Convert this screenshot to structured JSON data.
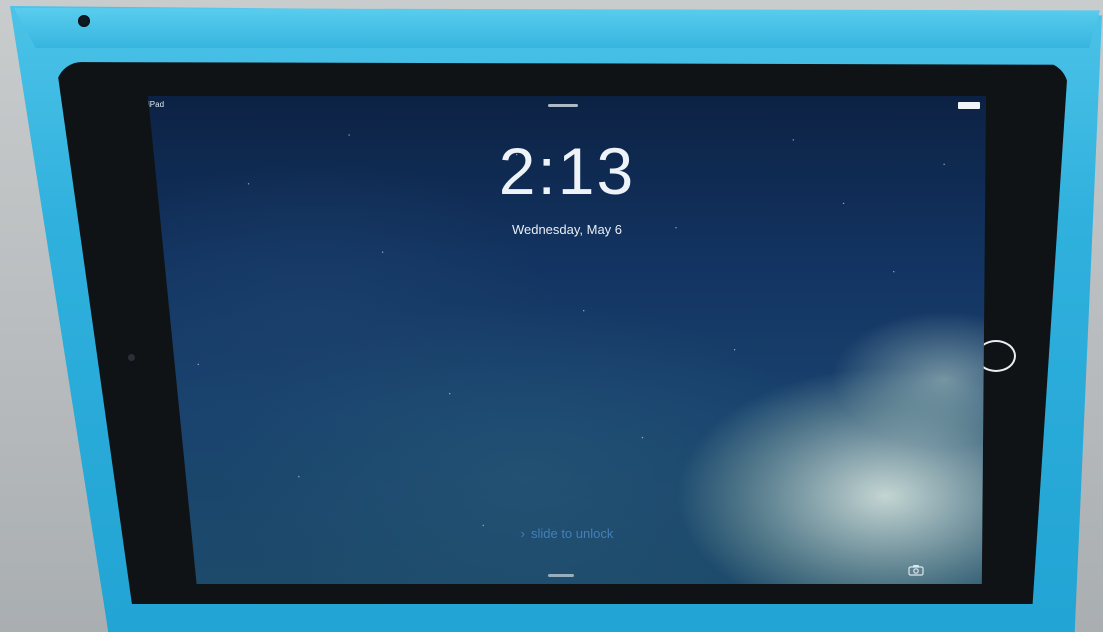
{
  "status_bar": {
    "carrier": "iPad"
  },
  "lock_screen": {
    "time": "2:13",
    "date": "Wednesday, May 6",
    "slide_to_unlock": "slide to unlock",
    "chevron_glyph": "›"
  },
  "icons": {
    "battery": "battery-icon",
    "camera": "camera-icon",
    "home_button": "home-button",
    "chevron": "chevron-right-icon"
  },
  "colors": {
    "case_blue": "#2fb0dd",
    "bezel": "#101316",
    "wallpaper_top": "#0c2244",
    "unlock_text": "#4682be"
  }
}
